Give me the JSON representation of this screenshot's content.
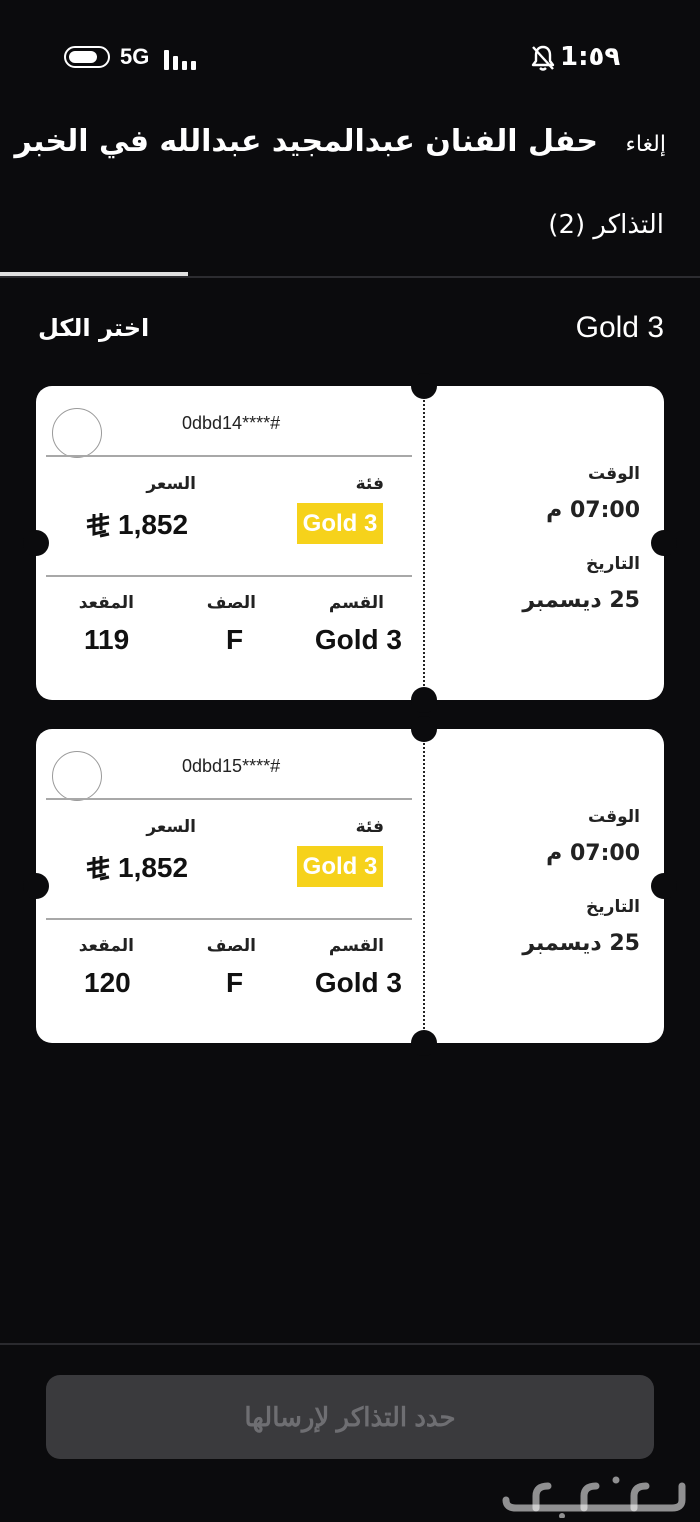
{
  "status_bar": {
    "network": "5G",
    "time": "1:٥٩",
    "icons": [
      "battery-icon",
      "signal-icon",
      "mute-icon"
    ]
  },
  "header": {
    "cancel_label": "إلغاء",
    "event_title": "حفل الفنان عبدالمجيد عبدالله في الخبر",
    "tab_label": "التذاكر (2)"
  },
  "section": {
    "title": "Gold 3",
    "select_all_label": "اختر الكل"
  },
  "labels": {
    "category": "فئة",
    "price": "السعر",
    "section": "القسم",
    "row": "الصف",
    "seat": "المقعد",
    "time": "الوقت",
    "date": "التاريخ"
  },
  "tickets": [
    {
      "id": "0dbd14****#",
      "category": "Gold 3",
      "price": "1,852",
      "section": "Gold 3",
      "row": "F",
      "seat": "119",
      "time": "07:00 م",
      "date": "25 ديسمبر"
    },
    {
      "id": "0dbd15****#",
      "category": "Gold 3",
      "price": "1,852",
      "section": "Gold 3",
      "row": "F",
      "seat": "120",
      "time": "07:00 م",
      "date": "25 ديسمبر"
    }
  ],
  "footer": {
    "send_button_label": "حدد التذاكر لإرسالها"
  },
  "colors": {
    "background": "#0b0b0d",
    "card": "#ffffff",
    "badge": "#f6d21b",
    "button_disabled": "#3a3a3d"
  }
}
